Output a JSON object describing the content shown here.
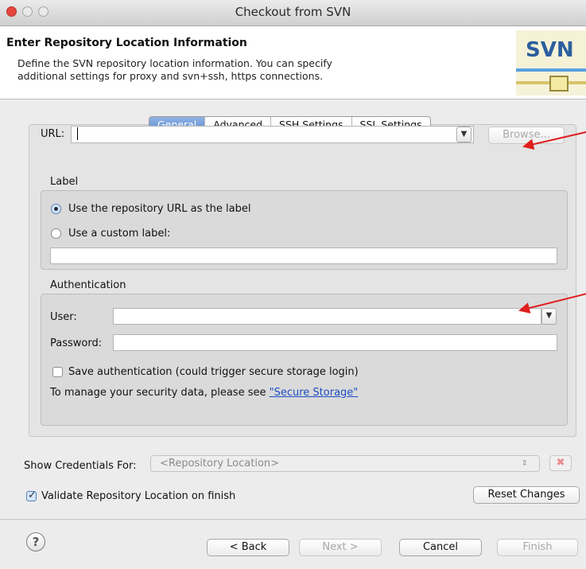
{
  "window": {
    "title": "Checkout from SVN"
  },
  "header": {
    "title": "Enter Repository Location Information",
    "description_line1": "Define the SVN repository location information. You can specify",
    "description_line2": "additional settings for proxy and svn+ssh, https connections.",
    "logo_text": "SVN"
  },
  "tabs": [
    "General",
    "Advanced",
    "SSH Settings",
    "SSL Settings"
  ],
  "active_tab": "General",
  "url": {
    "label": "URL:",
    "value": "",
    "browse_label": "Browse..."
  },
  "label_group": {
    "title": "Label",
    "option_repo_url": "Use the repository URL as the label",
    "option_custom": "Use a custom label:",
    "selected": "Use the repository URL as the label",
    "custom_value": ""
  },
  "auth": {
    "title": "Authentication",
    "user_label": "User:",
    "user_value": "",
    "password_label": "Password:",
    "password_value": "",
    "save_label": "Save authentication (could trigger secure storage login)",
    "save_checked": false,
    "manage_text": "To manage your security data, please see ",
    "manage_link": "\"Secure Storage\""
  },
  "credentials": {
    "label": "Show Credentials For:",
    "value": "<Repository Location>"
  },
  "validate": {
    "label": "Validate Repository Location on finish",
    "checked": true
  },
  "buttons": {
    "reset": "Reset Changes",
    "back": "< Back",
    "next": "Next >",
    "cancel": "Cancel",
    "finish": "Finish",
    "help": "?"
  },
  "colors": {
    "accent": "#5d8ad0",
    "annotation_arrow": "#e01e1e",
    "link": "#1b4ec2"
  }
}
